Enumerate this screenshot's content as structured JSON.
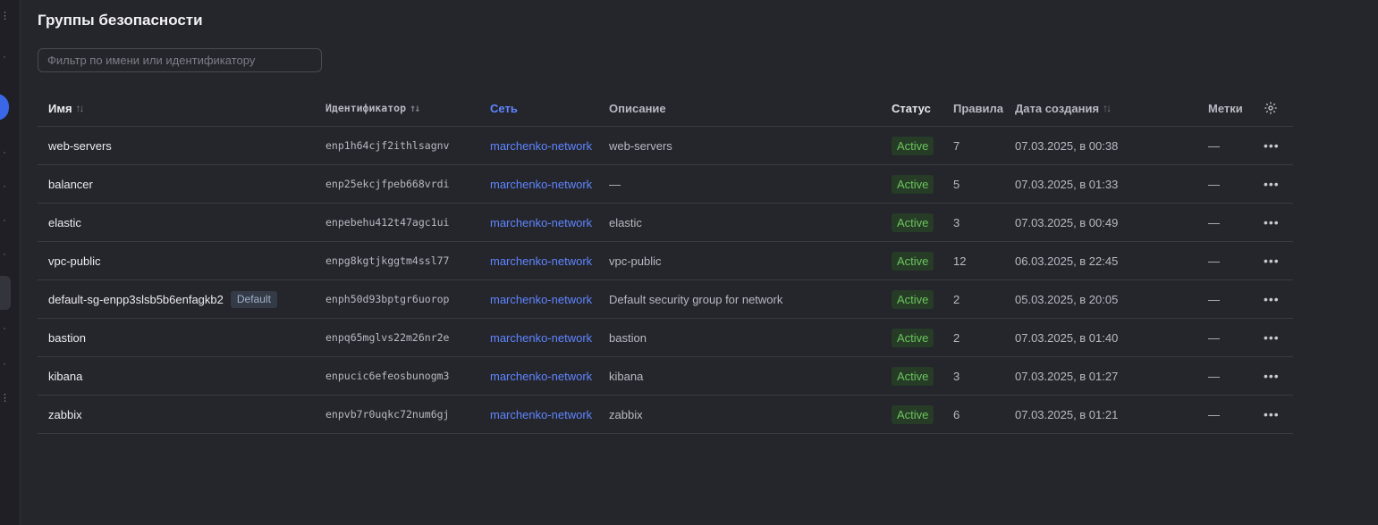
{
  "page": {
    "title": "Группы безопасности"
  },
  "filter": {
    "placeholder": "Фильтр по имени или идентификатору",
    "value": ""
  },
  "columns": {
    "name": "Имя",
    "id": "Идентификатор",
    "network": "Сеть",
    "description": "Описание",
    "status": "Статус",
    "rules": "Правила",
    "created": "Дата создания",
    "tags": "Метки"
  },
  "sort_glyph": "↑↓",
  "more_glyph": "•••",
  "icons": {
    "settings": "gear-icon",
    "row_menu": "more-horizontal-icon",
    "sort": "sort-icon"
  },
  "colors": {
    "link": "#5f86ff",
    "status_active_bg": "#263c27",
    "status_active_fg": "#6cc55d",
    "accent": "#3a66e8"
  },
  "rows": [
    {
      "name": "web-servers",
      "badge": "",
      "id": "enp1h64cjf2ithlsagnv",
      "network": "marchenko-network",
      "description": "web-servers",
      "status": "Active",
      "rules": "7",
      "created": "07.03.2025, в 00:38",
      "tags": "—"
    },
    {
      "name": "balancer",
      "badge": "",
      "id": "enp25ekcjfpeb668vrdi",
      "network": "marchenko-network",
      "description": "—",
      "status": "Active",
      "rules": "5",
      "created": "07.03.2025, в 01:33",
      "tags": "—"
    },
    {
      "name": "elastic",
      "badge": "",
      "id": "enpebehu412t47agc1ui",
      "network": "marchenko-network",
      "description": "elastic",
      "status": "Active",
      "rules": "3",
      "created": "07.03.2025, в 00:49",
      "tags": "—"
    },
    {
      "name": "vpc-public",
      "badge": "",
      "id": "enpg8kgtjkggtm4ssl77",
      "network": "marchenko-network",
      "description": "vpc-public",
      "status": "Active",
      "rules": "12",
      "created": "06.03.2025, в 22:45",
      "tags": "—"
    },
    {
      "name": "default-sg-enpp3slsb5b6enfagkb2",
      "badge": "Default",
      "id": "enph50d93bptgr6uorop",
      "network": "marchenko-network",
      "description": "Default security group for network",
      "status": "Active",
      "rules": "2",
      "created": "05.03.2025, в 20:05",
      "tags": "—"
    },
    {
      "name": "bastion",
      "badge": "",
      "id": "enpq65mglvs22m26nr2e",
      "network": "marchenko-network",
      "description": "bastion",
      "status": "Active",
      "rules": "2",
      "created": "07.03.2025, в 01:40",
      "tags": "—"
    },
    {
      "name": "kibana",
      "badge": "",
      "id": "enpucic6efeosbunogm3",
      "network": "marchenko-network",
      "description": "kibana",
      "status": "Active",
      "rules": "3",
      "created": "07.03.2025, в 01:27",
      "tags": "—"
    },
    {
      "name": "zabbix",
      "badge": "",
      "id": "enpvb7r0uqkc72num6gj",
      "network": "marchenko-network",
      "description": "zabbix",
      "status": "Active",
      "rules": "6",
      "created": "07.03.2025, в 01:21",
      "tags": "—"
    }
  ]
}
